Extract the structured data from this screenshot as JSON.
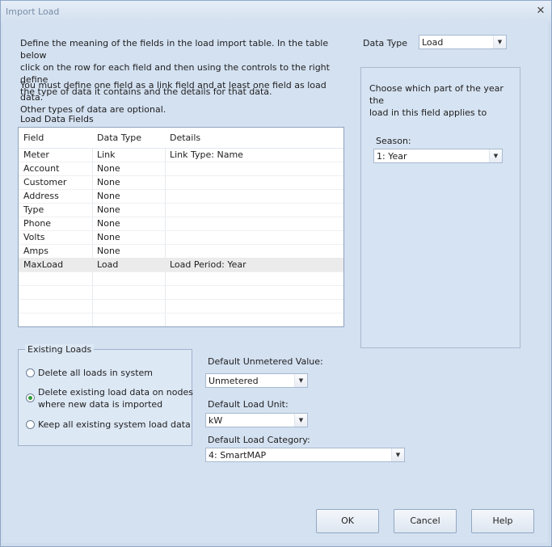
{
  "window": {
    "title": "Import Load"
  },
  "intro": {
    "lines1": [
      "Define the meaning of the fields in the load import table. In the table below",
      "click on the row for each field and then using the controls to the right define",
      "the type of data it contains and the details for that data."
    ],
    "lines2": [
      "You must define one field as a link field and at least one field as load data.",
      "Other types of data are optional."
    ]
  },
  "data_type": {
    "label": "Data Type",
    "value": "Load"
  },
  "right_panel": {
    "description_lines": [
      "Choose which part of the year the",
      "load in this field applies to"
    ],
    "season_label": "Season:",
    "season_value": "1: Year"
  },
  "fields_table": {
    "label": "Load Data Fields",
    "columns": [
      "Field",
      "Data Type",
      "Details"
    ],
    "rows": [
      [
        "Meter",
        "Link",
        "Link Type: Name"
      ],
      [
        "Account",
        "None",
        ""
      ],
      [
        "Customer",
        "None",
        ""
      ],
      [
        "Address",
        "None",
        ""
      ],
      [
        "Type",
        "None",
        ""
      ],
      [
        "Phone",
        "None",
        ""
      ],
      [
        "Volts",
        "None",
        ""
      ],
      [
        "Amps",
        "None",
        ""
      ],
      [
        "MaxLoad",
        "Load",
        "Load Period: Year"
      ]
    ],
    "selected_row": 8
  },
  "existing_loads": {
    "title": "Existing Loads",
    "options": [
      {
        "lines": [
          "Delete all loads in system"
        ],
        "selected": false
      },
      {
        "lines": [
          "Delete existing load data on nodes",
          "where new data is imported"
        ],
        "selected": true
      },
      {
        "lines": [
          "Keep all existing system load data"
        ],
        "selected": false
      }
    ]
  },
  "defaults": {
    "unmetered_label": "Default Unmetered Value:",
    "unmetered_value": "Unmetered",
    "unit_label": "Default Load Unit:",
    "unit_value": "kW",
    "category_label": "Default Load Category:",
    "category_value": "4: SmartMAP"
  },
  "buttons": {
    "ok": "OK",
    "cancel": "Cancel",
    "help": "Help"
  }
}
